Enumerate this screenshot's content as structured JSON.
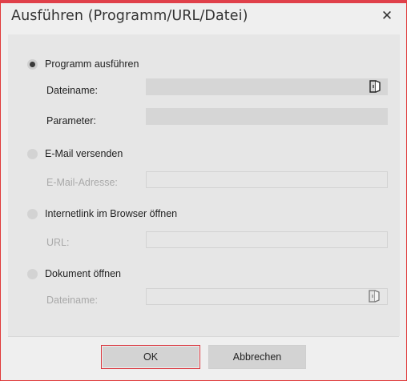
{
  "window": {
    "title": "Ausführen (Programm/URL/Datei)",
    "close_symbol": "✕",
    "accent_color": "#e0404a"
  },
  "options": {
    "run_program": {
      "label": "Programm ausführen",
      "selected": true,
      "filename_label": "Dateiname:",
      "filename_value": "",
      "parameter_label": "Parameter:",
      "parameter_value": "",
      "browse_icon": "folder-open-icon"
    },
    "send_email": {
      "label": "E-Mail versenden",
      "selected": false,
      "address_label": "E-Mail-Adresse:",
      "address_value": ""
    },
    "open_link": {
      "label": "Internetlink im Browser öffnen",
      "selected": false,
      "url_label": "URL:",
      "url_value": ""
    },
    "open_document": {
      "label": "Dokument öffnen",
      "selected": false,
      "filename_label": "Dateiname:",
      "filename_value": "",
      "browse_icon": "folder-open-icon"
    }
  },
  "buttons": {
    "ok": "OK",
    "cancel": "Abbrechen"
  }
}
